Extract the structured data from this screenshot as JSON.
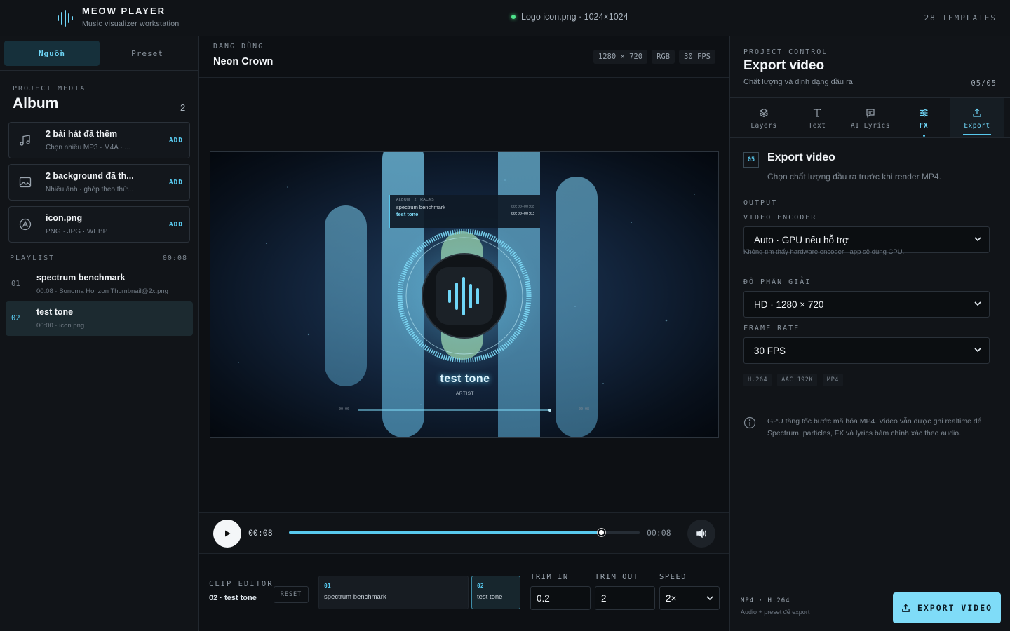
{
  "app": {
    "title": "MEOW PLAYER",
    "subtitle": "Music visualizer workstation",
    "status_file": "Logo icon.png · 1024×1024",
    "templates_count": "28 TEMPLATES"
  },
  "left": {
    "tabs": [
      {
        "label": "Nguồn",
        "active": true
      },
      {
        "label": "Preset",
        "active": false
      }
    ],
    "project_media_label": "PROJECT MEDIA",
    "album_title": "Album",
    "album_count": "2",
    "media": [
      {
        "icon": "music-note-icon",
        "title": "2 bài hát đã thêm",
        "sub": "Chọn nhiều MP3 · M4A · ...",
        "action": "ADD"
      },
      {
        "icon": "image-icon",
        "title": "2 background đã th...",
        "sub": "Nhiều ảnh · ghép theo thứ...",
        "action": "ADD"
      },
      {
        "icon": "app-logo-icon",
        "title": "icon.png",
        "sub": "PNG · JPG · WEBP",
        "action": "ADD"
      }
    ],
    "playlist_label": "PLAYLIST",
    "playlist_duration": "00:08",
    "playlist": [
      {
        "num": "01",
        "title": "spectrum benchmark",
        "sub": "00:08 · Sonoma Horizon Thumbnail@2x.png",
        "active": false
      },
      {
        "num": "02",
        "title": "test tone",
        "sub": "00:00 · icon.png",
        "active": true
      }
    ]
  },
  "center": {
    "now_label": "ĐANG DÙNG",
    "now_title": "Neon Crown",
    "specs": [
      "1280 × 720",
      "RGB",
      "30 FPS"
    ],
    "preview": {
      "card_header": "ALBUM · 2 TRACKS",
      "tracks": [
        {
          "name": "spectrum benchmark",
          "time": "00:00–00:08"
        },
        {
          "name": "test tone",
          "time": "00:00–00:03"
        }
      ],
      "song_title": "test tone",
      "artist": "ARTIST",
      "time_left": "00:00",
      "time_right": "00:08"
    },
    "transport": {
      "current": "00:08",
      "duration": "00:08",
      "progress": 0.89
    },
    "clip_editor": {
      "label": "CLIP EDITOR",
      "selected": "02 · test tone",
      "reset": "RESET",
      "clips": [
        {
          "num": "01",
          "name": "spectrum benchmark",
          "active": false
        },
        {
          "num": "02",
          "name": "test tone",
          "active": true
        }
      ],
      "trim_in_label": "TRIM IN",
      "trim_in": "0.2",
      "trim_out_label": "TRIM OUT",
      "trim_out": "2",
      "speed_label": "SPEED",
      "speed": "2×"
    }
  },
  "right": {
    "label": "PROJECT CONTROL",
    "title": "Export video",
    "subtitle": "Chất lượng và định dạng đầu ra",
    "step": "05/05",
    "tabs": [
      {
        "icon": "layers-icon",
        "label": "Layers"
      },
      {
        "icon": "text-icon",
        "label": "Text"
      },
      {
        "icon": "lyrics-icon",
        "label": "AI Lyrics"
      },
      {
        "icon": "sliders-icon",
        "label": "FX"
      },
      {
        "icon": "export-icon",
        "label": "Export"
      }
    ],
    "section_num": "05",
    "section_title": "Export video",
    "section_sub": "Chọn chất lượng đầu ra trước khi render MP4.",
    "output_label": "OUTPUT",
    "encoder_label": "VIDEO ENCODER",
    "encoder_value": "Auto · GPU nếu hỗ trợ",
    "encoder_hint": "Không tìm thấy hardware encoder · app sẽ dùng CPU.",
    "resolution_label": "ĐỘ PHÂN GIẢI",
    "resolution_value": "HD · 1280 × 720",
    "framerate_label": "FRAME RATE",
    "framerate_value": "30 FPS",
    "codecs": [
      "H.264",
      "AAC 192K",
      "MP4"
    ],
    "info": "GPU tăng tốc bước mã hóa MP4. Video vẫn được ghi realtime để Spectrum, particles, FX và lyrics bám chính xác theo audio.",
    "footer_codec": "MP4 · H.264",
    "footer_sub": "Audio + preset để export",
    "export_button": "EXPORT VIDEO"
  },
  "colors": {
    "accent": "#58c9ee",
    "export_button": "#7fdcf8",
    "status_dot": "#4ee38c",
    "background": "#0f1216"
  }
}
